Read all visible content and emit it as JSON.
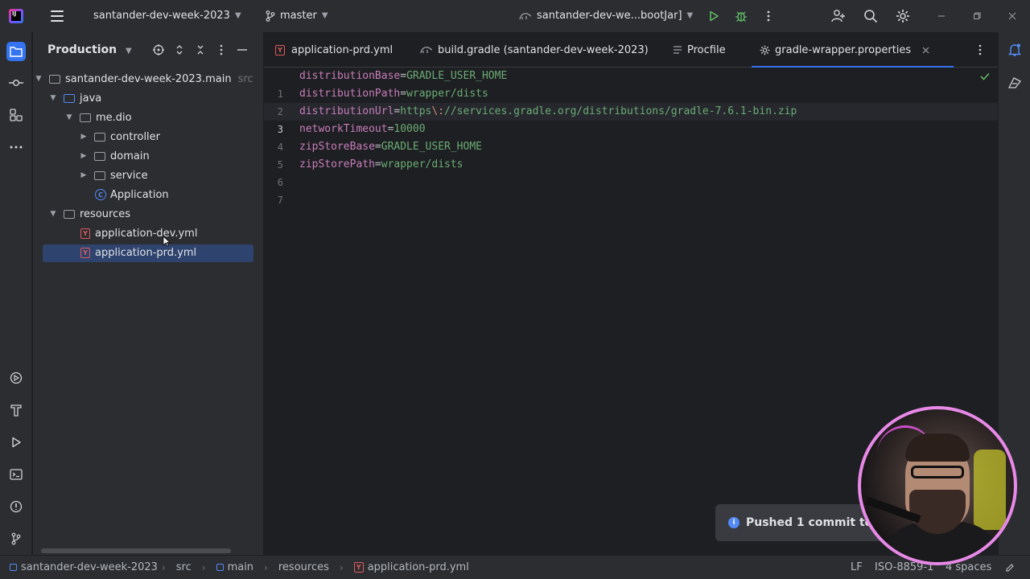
{
  "titlebar": {
    "project_name": "santander-dev-week-2023",
    "branch": "master",
    "run_config": "santander-dev-we...bootJar]"
  },
  "project_panel": {
    "title": "Production",
    "root_label": "santander-dev-week-2023.main",
    "root_suffix": "src",
    "items": [
      {
        "label": "java"
      },
      {
        "label": "me.dio"
      },
      {
        "label": "controller"
      },
      {
        "label": "domain"
      },
      {
        "label": "service"
      },
      {
        "label": "Application"
      },
      {
        "label": "resources"
      },
      {
        "label": "application-dev.yml"
      },
      {
        "label": "application-prd.yml"
      }
    ]
  },
  "tabs": [
    {
      "label": "application-prd.yml"
    },
    {
      "label": "build.gradle (santander-dev-week-2023)"
    },
    {
      "label": "Procfile"
    },
    {
      "label": "gradle-wrapper.properties"
    }
  ],
  "editor": {
    "active_file": "gradle-wrapper.properties",
    "current_line": 3,
    "lines": [
      {
        "num": "1",
        "key": "distributionBase",
        "eq": "=",
        "val": "GRADLE_USER_HOME",
        "rest": ""
      },
      {
        "num": "2",
        "key": "distributionPath",
        "eq": "=",
        "val": "wrapper/dists",
        "rest": ""
      },
      {
        "num": "3",
        "key": "distributionUrl",
        "eq": "=",
        "val": "https",
        "esc": "\\:",
        "rest": "//services.gradle.org/distributions/gradle-7.6.1-bin.zip"
      },
      {
        "num": "4",
        "key": "networkTimeout",
        "eq": "=",
        "val": "10000",
        "rest": ""
      },
      {
        "num": "5",
        "key": "zipStoreBase",
        "eq": "=",
        "val": "GRADLE_USER_HOME",
        "rest": ""
      },
      {
        "num": "6",
        "key": "zipStorePath",
        "eq": "=",
        "val": "wrapper/dists",
        "rest": ""
      },
      {
        "num": "7",
        "key": "",
        "eq": "",
        "val": "",
        "rest": ""
      }
    ]
  },
  "notification": {
    "text": "Pushed 1 commit to o"
  },
  "statusbar": {
    "breadcrumbs": [
      "santander-dev-week-2023",
      "src",
      "main",
      "resources",
      "application-prd.yml"
    ],
    "line_separator": "LF",
    "encoding": "ISO-8859-1",
    "indent": "4 spaces"
  },
  "colors": {
    "accent": "#3574f0",
    "key": "#c77dbb",
    "value": "#6aab73",
    "webcam_border": "#e889e8"
  }
}
